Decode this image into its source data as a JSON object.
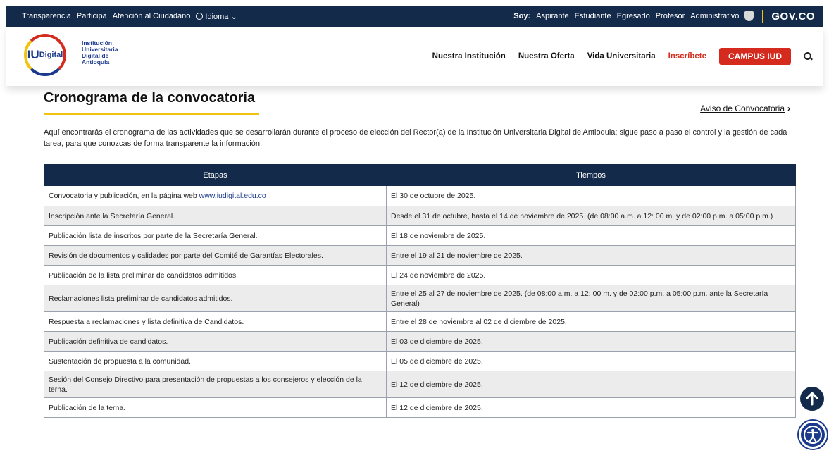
{
  "govbar": {
    "links": [
      "Transparencia",
      "Participa",
      "Atención al Ciudadano"
    ],
    "language": "Idioma",
    "soy_label": "Soy:",
    "audiences": [
      "Aspirante",
      "Estudiante",
      "Egresado",
      "Profesor",
      "Administrativo"
    ],
    "gov_logo": "GOV.CO"
  },
  "header": {
    "logo_iu": "IU",
    "logo_digital": "Digital",
    "logo_text": "Institución Universitaria Digital de Antioquia",
    "nav": [
      "Nuestra Institución",
      "Nuestra Oferta",
      "Vida Universitaria"
    ],
    "inscribete": "Inscríbete",
    "campus": "CAMPUS IUD"
  },
  "main": {
    "title": "Cronograma de la convocatoria",
    "aviso_link": "Aviso de Convocatoria",
    "intro": "Aquí encontrarás el cronograma de las actividades que se desarrollarán durante el proceso de elección del Rector(a) de la Institución Universitaria Digital de Antioquia; sigue paso a paso el control y la gestión de cada tarea, para que conozcas de forma transparente la información."
  },
  "table": {
    "headers": [
      "Etapas",
      "Tiempos"
    ],
    "rows": [
      {
        "etapa": "Convocatoria y publicación, en la página web ",
        "link": "www.iudigital.edu.co",
        "tiempo": "El 30 de octubre de 2025."
      },
      {
        "etapa": "Inscripción ante la Secretaría General.",
        "tiempo": "Desde el 31 de octubre, hasta el 14 de noviembre de 2025. (de 08:00 a.m. a 12: 00 m. y de 02:00 p.m. a 05:00 p.m.)"
      },
      {
        "etapa": "Publicación lista de inscritos por parte de la Secretaría General.",
        "tiempo": "El 18 de noviembre de 2025."
      },
      {
        "etapa": "Revisión de documentos y calidades por parte del Comité de Garantías Electorales.",
        "tiempo": "Entre el 19 al 21 de noviembre de 2025."
      },
      {
        "etapa": "Publicación de la lista preliminar de candidatos admitidos.",
        "tiempo": "El 24 de noviembre de 2025."
      },
      {
        "etapa": "Reclamaciones lista preliminar de candidatos admitidos.",
        "tiempo": "Entre el 25 al 27 de noviembre de 2025. (de 08:00 a.m. a 12: 00 m. y de 02:00 p.m. a 05:00 p.m. ante la Secretaría General)"
      },
      {
        "etapa": "Respuesta a reclamaciones y lista definitiva de Candidatos.",
        "tiempo": "Entre el 28 de noviembre al 02 de diciembre de 2025."
      },
      {
        "etapa": "Publicación definitiva de candidatos.",
        "tiempo": "El 03 de diciembre de 2025."
      },
      {
        "etapa": "Sustentación de propuesta a la comunidad.",
        "tiempo": "El 05 de diciembre de 2025."
      },
      {
        "etapa": "Sesión del Consejo Directivo para presentación de propuestas a los consejeros y elección de la terna.",
        "tiempo": "El 12 de diciembre de 2025."
      },
      {
        "etapa": "Publicación de la terna.",
        "tiempo": "El 12 de diciembre de 2025."
      }
    ]
  },
  "colors": {
    "navy": "#142a4a",
    "red": "#d52b1e",
    "yellow": "#f3c20f"
  }
}
